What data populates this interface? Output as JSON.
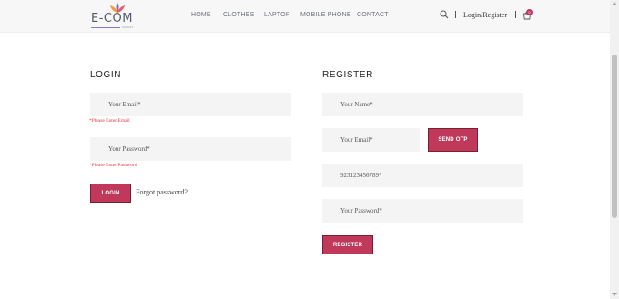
{
  "header": {
    "logo_text": "E-COM",
    "logo_tagline": "MARKET",
    "nav": [
      "HOME",
      "CLOTHES",
      "LAPTOP",
      "MOBILE PHONE",
      "CONTACT"
    ],
    "login_register": "Login/Register",
    "cart_count": "0",
    "icons": [
      "search-icon",
      "cart-icon"
    ]
  },
  "login": {
    "title": "LOGIN",
    "email_placeholder": "Your Email*",
    "email_error": "*Please Enter Email",
    "password_placeholder": "Your Password*",
    "password_error": "*Please Enter Password",
    "button": "LOGIN",
    "forgot": "Forgot password?"
  },
  "register": {
    "title": "REGISTER",
    "name_placeholder": "Your Name*",
    "email_placeholder": "Your Email*",
    "otp_button": "SEND OTP",
    "phone_placeholder": "923123456789*",
    "password_placeholder": "Your Password*",
    "button": "REGISTER"
  },
  "colors": {
    "accent": "#c0395b",
    "error": "#e0393e",
    "field_bg": "#f4f4f4"
  }
}
